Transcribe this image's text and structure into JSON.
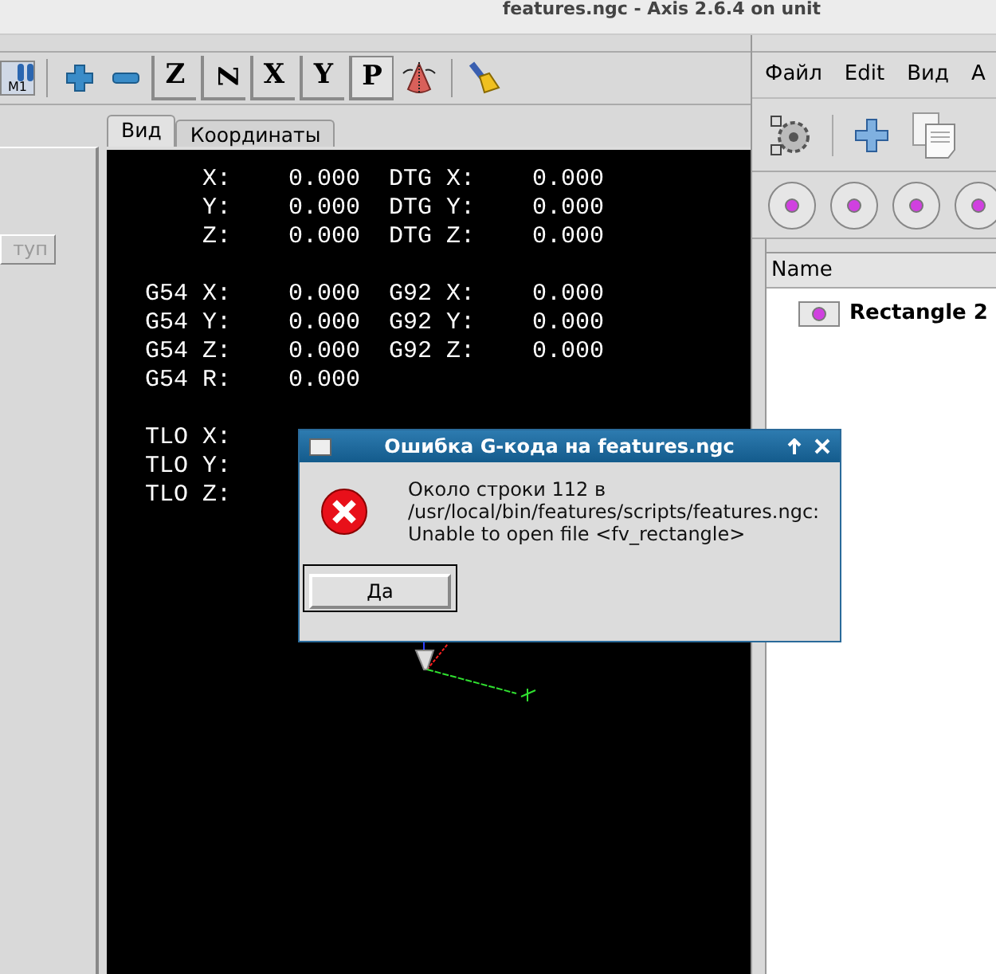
{
  "window": {
    "title": "features.ngc - Axis 2.6.4 on unit"
  },
  "toolbar": [
    {
      "kind": "machine",
      "label": "M1"
    },
    {
      "kind": "separator"
    },
    {
      "kind": "zoom_in"
    },
    {
      "kind": "zoom_out"
    },
    {
      "kind": "view",
      "label": "Z",
      "selected": false
    },
    {
      "kind": "view_rotated",
      "label": "Z",
      "selected": false
    },
    {
      "kind": "view",
      "label": "X",
      "selected": false
    },
    {
      "kind": "view",
      "label": "Y",
      "selected": false
    },
    {
      "kind": "view",
      "label": "P",
      "selected": true
    },
    {
      "kind": "cone"
    },
    {
      "kind": "separator"
    },
    {
      "kind": "brush"
    }
  ],
  "left_panel": {
    "button": {
      "label": "туп",
      "disabled": true
    }
  },
  "tabs": [
    {
      "label": "Вид",
      "selected": true
    },
    {
      "label": "Координаты",
      "selected": false
    }
  ],
  "dro": {
    "groups": [
      [
        "    X:    0.000  DTG X:    0.000",
        "    Y:    0.000  DTG Y:    0.000",
        "    Z:    0.000  DTG Z:    0.000"
      ],
      [
        "G54 X:    0.000  G92 X:    0.000",
        "G54 Y:    0.000  G92 Y:    0.000",
        "G54 Z:    0.000  G92 Z:    0.000",
        "G54 R:    0.000"
      ],
      [
        "TLO X:",
        "TLO Y:",
        "TLO Z:"
      ]
    ]
  },
  "dialog": {
    "title": "Ошибка G-кода на features.ngc",
    "message": "Около строки 112 в\n/usr/local/bin/features/scripts/features.ngc:\nUnable to open file <fv_rectangle>",
    "button": "Да"
  },
  "side_window": {
    "menu": [
      "Файл",
      "Edit",
      "Вид",
      "A"
    ],
    "tree": {
      "column": "Name",
      "rows": [
        {
          "label": "Rectangle 2"
        }
      ]
    }
  }
}
